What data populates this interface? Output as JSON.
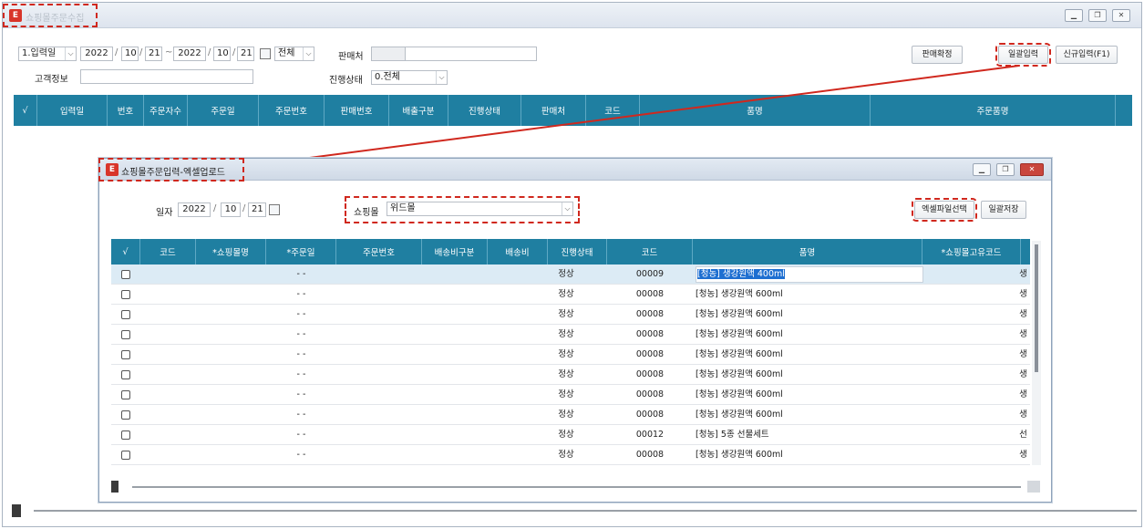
{
  "main_window": {
    "title": "쇼핑몰주문수집",
    "filters": {
      "date_type": "1.입력일",
      "from_year": "2022",
      "from_month": "10",
      "from_day": "21",
      "range_sep": "~",
      "to_year": "2022",
      "to_month": "10",
      "to_day": "21",
      "period_select": "전체",
      "seller_label": "판매처",
      "customer_label": "고객정보",
      "status_label": "진행상태",
      "status_select": "0.전체"
    },
    "buttons": {
      "confirm": "판매확정",
      "bulk_input": "일괄입력",
      "new_input": "신규입력(F1)"
    },
    "grid_headers": [
      "√",
      "입력일",
      "번호",
      "주문자수",
      "주문일",
      "주문번호",
      "판매번호",
      "배출구분",
      "진행상태",
      "판매처",
      "코드",
      "품명",
      "주문품명"
    ]
  },
  "sub_window": {
    "title": "쇼핑몰주문입력-엑셀업로드",
    "date_label": "일자",
    "year": "2022",
    "month": "10",
    "day": "21",
    "mall_label": "쇼핑몰",
    "mall_value": "위드몰",
    "buttons": {
      "excel_select": "엑셀파일선택",
      "bulk_save": "일괄저장"
    },
    "grid_headers": [
      "√",
      "코드",
      "*쇼핑몰명",
      "*주문일",
      "주문번호",
      "배송비구분",
      "배송비",
      "진행상태",
      "코드",
      "품명",
      "*쇼핑몰고유코드"
    ],
    "rows": [
      {
        "date": "- -",
        "status": "정상",
        "code": "00009",
        "name": "[청농] 생강원액 400ml",
        "extra": "생"
      },
      {
        "date": "- -",
        "status": "정상",
        "code": "00008",
        "name": "[청농] 생강원액 600ml",
        "extra": "생"
      },
      {
        "date": "- -",
        "status": "정상",
        "code": "00008",
        "name": "[청농] 생강원액 600ml",
        "extra": "생"
      },
      {
        "date": "- -",
        "status": "정상",
        "code": "00008",
        "name": "[청농] 생강원액 600ml",
        "extra": "생"
      },
      {
        "date": "- -",
        "status": "정상",
        "code": "00008",
        "name": "[청농] 생강원액 600ml",
        "extra": "생"
      },
      {
        "date": "- -",
        "status": "정상",
        "code": "00008",
        "name": "[청농] 생강원액 600ml",
        "extra": "생"
      },
      {
        "date": "- -",
        "status": "정상",
        "code": "00008",
        "name": "[청농] 생강원액 600ml",
        "extra": "생"
      },
      {
        "date": "- -",
        "status": "정상",
        "code": "00008",
        "name": "[청농] 생강원액 600ml",
        "extra": "생"
      },
      {
        "date": "- -",
        "status": "정상",
        "code": "00012",
        "name": "[청농] 5종 선물세트",
        "extra": "선"
      },
      {
        "date": "- -",
        "status": "정상",
        "code": "00008",
        "name": "[청농] 생강원액 600ml",
        "extra": "생"
      }
    ]
  },
  "colors": {
    "grid_header": "#1f7fa1",
    "highlight": "#d0281e",
    "selected_row": "#dcebf5",
    "selected_text_bg": "#1e6fd1"
  }
}
